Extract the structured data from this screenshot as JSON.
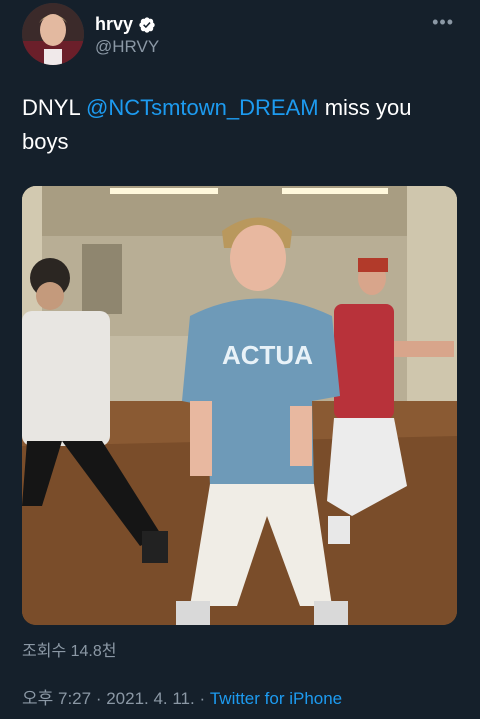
{
  "author": {
    "display_name": "hrvy",
    "handle": "@HRVY",
    "verified": true
  },
  "tweet": {
    "text_before": "DNYL ",
    "mention": "@NCTsmtown_DREAM",
    "text_after": " miss you boys"
  },
  "stats": {
    "views": "조회수 14.8천"
  },
  "meta": {
    "time": "오후 7:27",
    "separator": " · ",
    "date": "2021. 4. 11.",
    "source": "Twitter for iPhone"
  },
  "icons": {
    "more": "more-horizontal-icon",
    "verified": "verified-badge-icon"
  },
  "colors": {
    "background": "#15202b",
    "link": "#1d9bf0",
    "secondary_text": "#8b98a5"
  }
}
